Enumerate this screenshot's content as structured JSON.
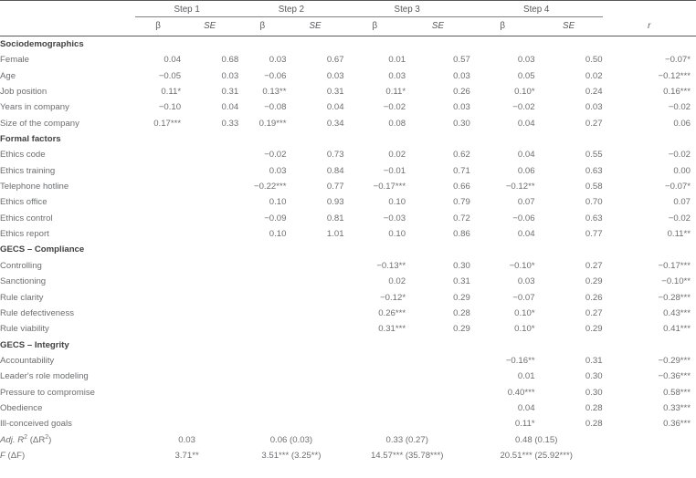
{
  "table": {
    "header": {
      "steps": [
        "Step 1",
        "Step 2",
        "Step 3",
        "Step 4"
      ],
      "beta_label": "β",
      "se_label": "SE",
      "r_label": "r"
    },
    "sections": [
      {
        "title": "Sociodemographics",
        "rows": [
          {
            "label": "Female",
            "b1": "0.04",
            "s1": "0.68",
            "b2": "0.03",
            "s2": "0.67",
            "b3": "0.01",
            "s3": "0.57",
            "b4": "0.03",
            "s4": "0.50",
            "r": "−0.07*"
          },
          {
            "label": "Age",
            "b1": "−0.05",
            "s1": "0.03",
            "b2": "−0.06",
            "s2": "0.03",
            "b3": "0.03",
            "s3": "0.03",
            "b4": "0.05",
            "s4": "0.02",
            "r": "−0.12***"
          },
          {
            "label": "Job position",
            "b1": "0.11*",
            "s1": "0.31",
            "b2": "0.13**",
            "s2": "0.31",
            "b3": "0.11*",
            "s3": "0.26",
            "b4": "0.10*",
            "s4": "0.24",
            "r": "0.16***"
          },
          {
            "label": "Years in company",
            "b1": "−0.10",
            "s1": "0.04",
            "b2": "−0.08",
            "s2": "0.04",
            "b3": "−0.02",
            "s3": "0.03",
            "b4": "−0.02",
            "s4": "0.03",
            "r": "−0.02"
          },
          {
            "label": "Size of the company",
            "b1": "0.17***",
            "s1": "0.33",
            "b2": "0.19***",
            "s2": "0.34",
            "b3": "0.08",
            "s3": "0.30",
            "b4": "0.04",
            "s4": "0.27",
            "r": "0.06"
          }
        ]
      },
      {
        "title": "Formal factors",
        "rows": [
          {
            "label": "Ethics code",
            "b1": "",
            "s1": "",
            "b2": "−0.02",
            "s2": "0.73",
            "b3": "0.02",
            "s3": "0.62",
            "b4": "0.04",
            "s4": "0.55",
            "r": "−0.02"
          },
          {
            "label": "Ethics training",
            "b1": "",
            "s1": "",
            "b2": "0.03",
            "s2": "0.84",
            "b3": "−0.01",
            "s3": "0.71",
            "b4": "0.06",
            "s4": "0.63",
            "r": "0.00"
          },
          {
            "label": "Telephone hotline",
            "b1": "",
            "s1": "",
            "b2": "−0.22***",
            "s2": "0.77",
            "b3": "−0.17***",
            "s3": "0.66",
            "b4": "−0.12**",
            "s4": "0.58",
            "r": "−0.07*"
          },
          {
            "label": "Ethics office",
            "b1": "",
            "s1": "",
            "b2": "0.10",
            "s2": "0.93",
            "b3": "0.10",
            "s3": "0.79",
            "b4": "0.07",
            "s4": "0.70",
            "r": "0.07"
          },
          {
            "label": "Ethics control",
            "b1": "",
            "s1": "",
            "b2": "−0.09",
            "s2": "0.81",
            "b3": "−0.03",
            "s3": "0.72",
            "b4": "−0.06",
            "s4": "0.63",
            "r": "−0.02"
          },
          {
            "label": "Ethics report",
            "b1": "",
            "s1": "",
            "b2": "0.10",
            "s2": "1.01",
            "b3": "0.10",
            "s3": "0.86",
            "b4": "0.04",
            "s4": "0.77",
            "r": "0.11**"
          }
        ]
      },
      {
        "title": "GECS – Compliance",
        "rows": [
          {
            "label": "Controlling",
            "b1": "",
            "s1": "",
            "b2": "",
            "s2": "",
            "b3": "−0.13**",
            "s3": "0.30",
            "b4": "−0.10*",
            "s4": "0.27",
            "r": "−0.17***"
          },
          {
            "label": "Sanctioning",
            "b1": "",
            "s1": "",
            "b2": "",
            "s2": "",
            "b3": "0.02",
            "s3": "0.31",
            "b4": "0.03",
            "s4": "0.29",
            "r": "−0.10**"
          },
          {
            "label": "Rule clarity",
            "b1": "",
            "s1": "",
            "b2": "",
            "s2": "",
            "b3": "−0.12*",
            "s3": "0.29",
            "b4": "−0.07",
            "s4": "0.26",
            "r": "−0.28***"
          },
          {
            "label": "Rule defectiveness",
            "b1": "",
            "s1": "",
            "b2": "",
            "s2": "",
            "b3": "0.26***",
            "s3": "0.28",
            "b4": "0.10*",
            "s4": "0.27",
            "r": "0.43***"
          },
          {
            "label": "Rule viability",
            "b1": "",
            "s1": "",
            "b2": "",
            "s2": "",
            "b3": "0.31***",
            "s3": "0.29",
            "b4": "0.10*",
            "s4": "0.29",
            "r": "0.41***"
          }
        ]
      },
      {
        "title": "GECS – Integrity",
        "rows": [
          {
            "label": "Accountability",
            "b1": "",
            "s1": "",
            "b2": "",
            "s2": "",
            "b3": "",
            "s3": "",
            "b4": "−0.16**",
            "s4": "0.31",
            "r": "−0.29***"
          },
          {
            "label": "Leader's role modeling",
            "b1": "",
            "s1": "",
            "b2": "",
            "s2": "",
            "b3": "",
            "s3": "",
            "b4": "0.01",
            "s4": "0.30",
            "r": "−0.36***"
          },
          {
            "label": "Pressure to compromise",
            "b1": "",
            "s1": "",
            "b2": "",
            "s2": "",
            "b3": "",
            "s3": "",
            "b4": "0.40***",
            "s4": "0.30",
            "r": "0.58***"
          },
          {
            "label": "Obedience",
            "b1": "",
            "s1": "",
            "b2": "",
            "s2": "",
            "b3": "",
            "s3": "",
            "b4": "0.04",
            "s4": "0.28",
            "r": "0.33***"
          },
          {
            "label": "Ill-conceived goals",
            "b1": "",
            "s1": "",
            "b2": "",
            "s2": "",
            "b3": "",
            "s3": "",
            "b4": "0.11*",
            "s4": "0.28",
            "r": "0.36***"
          }
        ]
      }
    ],
    "summary": [
      {
        "name": "adj-r2",
        "label_parts": {
          "italic1": "Adj. R",
          "sup1": "2",
          "paren_open": " (ΔR",
          "sup2": "2",
          "paren_close": ")"
        },
        "step1": "0.03",
        "step2": "0.06 (0.03)",
        "step3": "0.33 (0.27)",
        "step4": "0.48 (0.15)"
      },
      {
        "name": "f-change",
        "label_parts": {
          "italic1": "F",
          "sup1": "",
          "paren_open": " (ΔF",
          "sup2": "",
          "paren_close": ")"
        },
        "step1": "3.71**",
        "step2": "3.51*** (3.25**)",
        "step3": "14.57*** (35.78***)",
        "step4": "20.51*** (25.92***)"
      }
    ]
  },
  "colors": {
    "rule": "#58595b",
    "spanner_rule": "#808184",
    "body_text": "#6d6e70",
    "section_text": "#414042"
  }
}
